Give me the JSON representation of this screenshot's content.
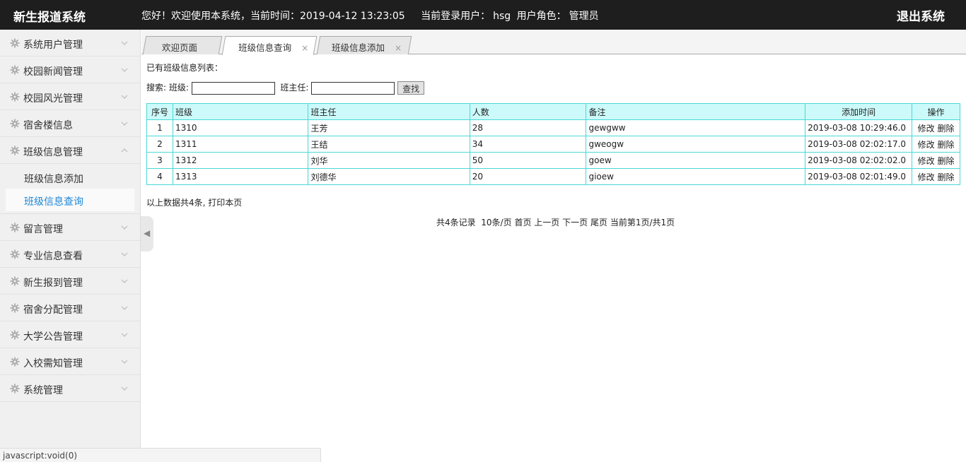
{
  "header": {
    "title": "新生报道系统",
    "welcome": "您好！欢迎使用本系统，当前时间：2019-04-12 13:23:05",
    "user_label": "当前登录用户：",
    "user_name": "hsg",
    "role_label": "用户角色：",
    "role_name": "管理员",
    "logout": "退出系统"
  },
  "sidebar": {
    "items": [
      {
        "label": "系统用户管理"
      },
      {
        "label": "校园新闻管理"
      },
      {
        "label": "校园风光管理"
      },
      {
        "label": "宿舍楼信息"
      },
      {
        "label": "班级信息管理"
      },
      {
        "label": "留言管理"
      },
      {
        "label": "专业信息查看"
      },
      {
        "label": "新生报到管理"
      },
      {
        "label": "宿舍分配管理"
      },
      {
        "label": "大学公告管理"
      },
      {
        "label": "入校需知管理"
      },
      {
        "label": "系统管理"
      }
    ],
    "submenu": [
      {
        "label": "班级信息添加"
      },
      {
        "label": "班级信息查询"
      }
    ]
  },
  "tabs": [
    {
      "label": "欢迎页面"
    },
    {
      "label": "班级信息查询",
      "close": "×"
    },
    {
      "label": "班级信息添加",
      "close": "×"
    }
  ],
  "main": {
    "list_title": "已有班级信息列表：",
    "search_label": "搜索:",
    "class_label": "班级:",
    "class_value": "",
    "teacher_label": "班主任:",
    "teacher_value": "",
    "search_button": "查找",
    "columns": [
      "序号",
      "班级",
      "班主任",
      "人数",
      "备注",
      "添加时间",
      "操作"
    ],
    "rows": [
      {
        "idx": "1",
        "cls": "1310",
        "teacher": "王芳",
        "count": "28",
        "note": "gewgww",
        "time": "2019-03-08 10:29:46.0",
        "edit": "修改",
        "del": "删除"
      },
      {
        "idx": "2",
        "cls": "1311",
        "teacher": "王结",
        "count": "34",
        "note": "gweogw",
        "time": "2019-03-08 02:02:17.0",
        "edit": "修改",
        "del": "删除"
      },
      {
        "idx": "3",
        "cls": "1312",
        "teacher": "刘华",
        "count": "50",
        "note": "goew",
        "time": "2019-03-08 02:02:02.0",
        "edit": "修改",
        "del": "删除"
      },
      {
        "idx": "4",
        "cls": "1313",
        "teacher": "刘德华",
        "count": "20",
        "note": "gioew",
        "time": "2019-03-08 02:01:49.0",
        "edit": "修改",
        "del": "删除"
      }
    ],
    "summary_text": "以上数据共4条,",
    "print_link": "打印本页",
    "pager": {
      "total": "共4条记录",
      "per_page": "10条/页",
      "first": "首页",
      "prev": "上一页",
      "next": "下一页",
      "last": "尾页",
      "current": "当前第1页/共1页"
    }
  },
  "statusbar": {
    "text": "javascript:void(0)"
  },
  "colors": {
    "header_bg": "#1e1e1e",
    "table_border": "#4ad7d7",
    "table_header_bg": "#ccfafa",
    "active_link": "#1e88d8"
  }
}
